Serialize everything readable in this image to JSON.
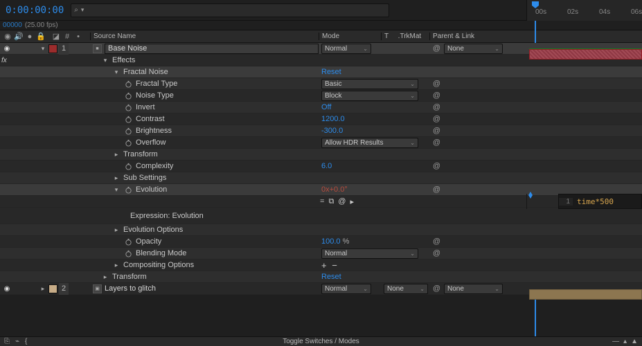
{
  "timecode": "0:00:00:00",
  "frame_info": "00000",
  "fps": "(25.00 fps)",
  "ruler": {
    "marks": [
      "00s",
      "02s",
      "04s",
      "06s"
    ]
  },
  "columns": {
    "hash": "#",
    "source_name": "Source Name",
    "mode": "Mode",
    "t": "T",
    "trkmat": ".TrkMat",
    "parent": "Parent & Link"
  },
  "layers": [
    {
      "num": "1",
      "color": "#9b2c2c",
      "name": "Base Noise",
      "mode": "Normal",
      "parent": "None"
    },
    {
      "num": "2",
      "color": "#c7ac87",
      "name": "Layers to glitch",
      "mode": "Normal",
      "trkmat": "None",
      "parent": "None"
    }
  ],
  "effects_label": "Effects",
  "effect": {
    "name": "Fractal Noise",
    "reset": "Reset",
    "props": {
      "fractal_type": {
        "label": "Fractal Type",
        "value": "Basic"
      },
      "noise_type": {
        "label": "Noise Type",
        "value": "Block"
      },
      "invert": {
        "label": "Invert",
        "value": "Off"
      },
      "contrast": {
        "label": "Contrast",
        "value": "1200.0"
      },
      "brightness": {
        "label": "Brightness",
        "value": "-300.0"
      },
      "overflow": {
        "label": "Overflow",
        "value": "Allow HDR Results"
      },
      "transform": {
        "label": "Transform"
      },
      "complexity": {
        "label": "Complexity",
        "value": "6.0"
      },
      "sub_settings": {
        "label": "Sub Settings"
      },
      "evolution": {
        "label": "Evolution",
        "rot_x": "0",
        "rot_xlabel": "x",
        "rot_deg": "+0.0°"
      },
      "expression_label": "Expression: Evolution",
      "evolution_opts": {
        "label": "Evolution Options"
      },
      "opacity": {
        "label": "Opacity",
        "value": "100.0",
        "unit": "%"
      },
      "blending": {
        "label": "Blending Mode",
        "value": "Normal"
      },
      "compositing": {
        "label": "Compositing Options"
      }
    }
  },
  "transform_group": {
    "label": "Transform",
    "reset": "Reset"
  },
  "expression": {
    "lineno": "1",
    "code": "time*500"
  },
  "footer": {
    "toggle": "Toggle Switches / Modes"
  }
}
